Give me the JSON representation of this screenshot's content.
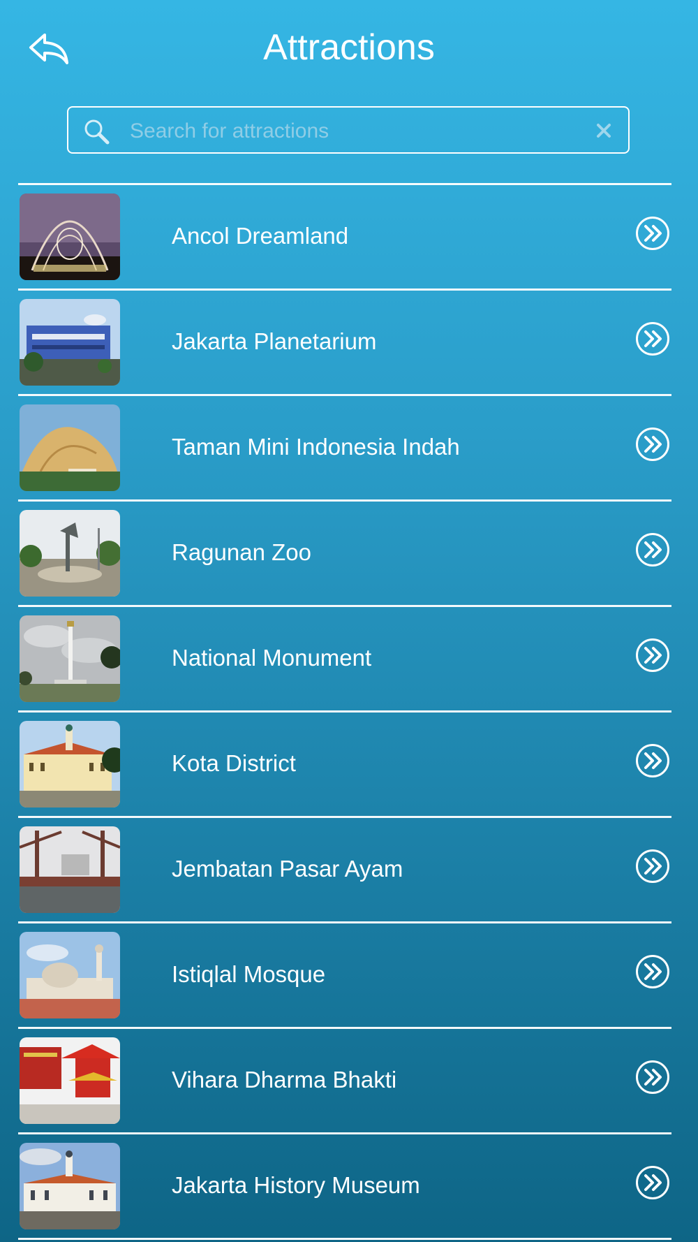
{
  "header": {
    "title": "Attractions",
    "back_icon": "back-reply-icon"
  },
  "search": {
    "placeholder": "Search for attractions",
    "value": "",
    "icon": "search-icon",
    "clear_icon": "close-icon"
  },
  "attractions": [
    {
      "name": "Ancol Dreamland",
      "thumb": "ancol",
      "arrow_icon": "chevron-double-right-icon"
    },
    {
      "name": "Jakarta Planetarium",
      "thumb": "planetarium",
      "arrow_icon": "chevron-double-right-icon"
    },
    {
      "name": "Taman Mini Indonesia Indah",
      "thumb": "taman-mini",
      "arrow_icon": "chevron-double-right-icon"
    },
    {
      "name": "Ragunan Zoo",
      "thumb": "ragunan",
      "arrow_icon": "chevron-double-right-icon"
    },
    {
      "name": "National Monument",
      "thumb": "monas",
      "arrow_icon": "chevron-double-right-icon"
    },
    {
      "name": "Kota District",
      "thumb": "kota",
      "arrow_icon": "chevron-double-right-icon"
    },
    {
      "name": "Jembatan Pasar Ayam",
      "thumb": "jembatan",
      "arrow_icon": "chevron-double-right-icon"
    },
    {
      "name": "Istiqlal Mosque",
      "thumb": "istiqlal",
      "arrow_icon": "chevron-double-right-icon"
    },
    {
      "name": "Vihara Dharma Bhakti",
      "thumb": "vihara",
      "arrow_icon": "chevron-double-right-icon"
    },
    {
      "name": "Jakarta History Museum",
      "thumb": "history-museum",
      "arrow_icon": "chevron-double-right-icon"
    }
  ],
  "colors": {
    "background_top": "#35b6e4",
    "background_bottom": "#0e6586",
    "text": "#ffffff",
    "placeholder": "#8fcde6"
  }
}
